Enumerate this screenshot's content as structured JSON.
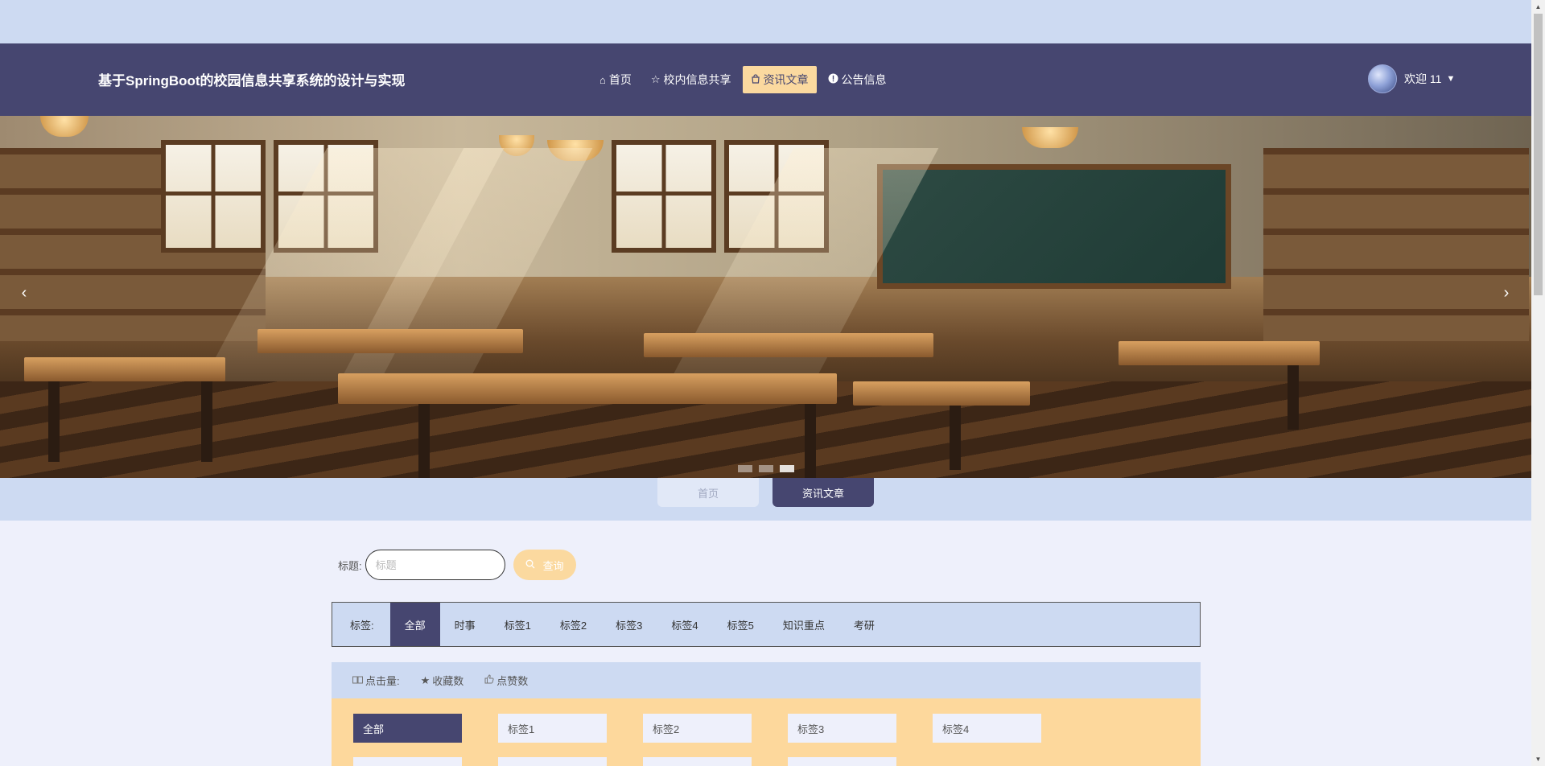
{
  "header": {
    "title": "基于SpringBoot的校园信息共享系统的设计与实现",
    "nav": [
      {
        "label": "首页",
        "icon": "home-icon"
      },
      {
        "label": "校内信息共享",
        "icon": "star-icon"
      },
      {
        "label": "资讯文章",
        "icon": "bag-icon",
        "active": true
      },
      {
        "label": "公告信息",
        "icon": "info-circle-icon"
      }
    ],
    "user": {
      "greeting": "欢迎 11"
    }
  },
  "banner": {
    "prev": "‹",
    "next": "›",
    "slides": 3,
    "active_slide": 2
  },
  "breadcrumb": {
    "home": "首页",
    "current": "资讯文章"
  },
  "search": {
    "label": "标题:",
    "placeholder": "标题",
    "button": "查询"
  },
  "tags": {
    "label": "标签:",
    "items": [
      "全部",
      "时事",
      "标签1",
      "标签2",
      "标签3",
      "标签4",
      "标签5",
      "知识重点",
      "考研"
    ],
    "active": "全部"
  },
  "sort": {
    "items": [
      "点击量:",
      "收藏数",
      "点赞数"
    ]
  },
  "categories": {
    "items": [
      "全部",
      "标签1",
      "标签2",
      "标签3",
      "标签4"
    ],
    "active": "全部"
  },
  "colors": {
    "primary": "#464670",
    "accent": "#fbd99f",
    "light": "#cddaf2",
    "page_bg": "#eef0fb"
  }
}
